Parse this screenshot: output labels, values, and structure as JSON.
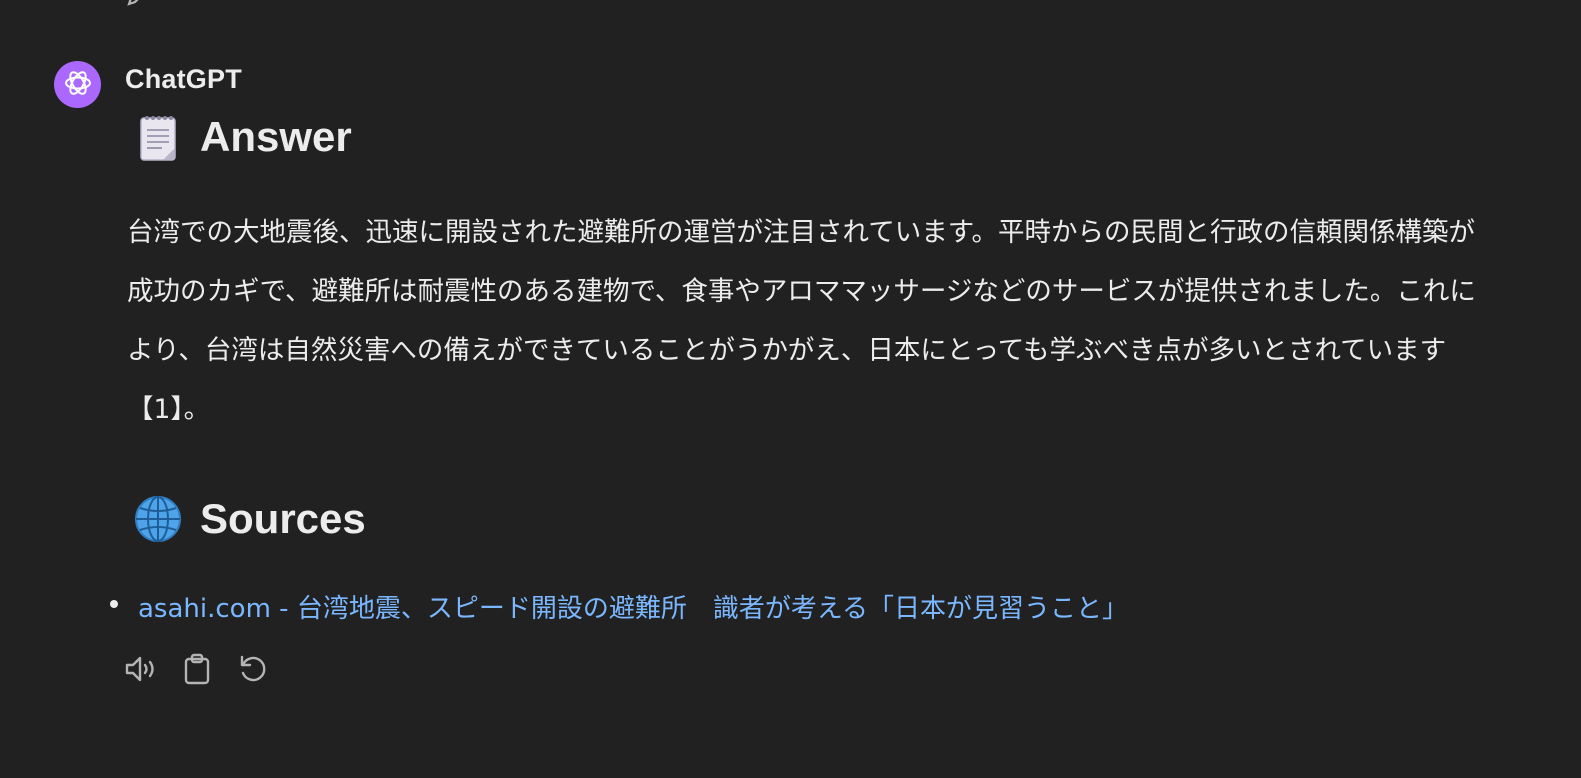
{
  "message": {
    "author": "ChatGPT",
    "answer_heading": "Answer",
    "answer_text": "台湾での大地震後、迅速に開設された避難所の運営が注目されています。平時からの民間と行政の信頼関係構築が成功のカギで、避難所は耐震性のある建物で、食事やアロママッサージなどのサービスが提供されました。これにより、台湾は自然災害への備えができていることがうかがえ、日本にとっても学ぶべき点が多いとされています【1】。",
    "sources_heading": "Sources",
    "sources": [
      {
        "label": "asahi.com - 台湾地震、スピード開設の避難所　識者が考える「日本が見習うこと」"
      }
    ]
  },
  "icons": {
    "avatar": "openai-logo-icon",
    "answer_emoji": "notepad-icon",
    "sources_emoji": "globe-icon",
    "actions": [
      "read-aloud-icon",
      "copy-icon",
      "regenerate-icon"
    ]
  },
  "colors": {
    "background": "#212121",
    "text": "#ececec",
    "link": "#7ab7ff",
    "avatar": "#ab68ff"
  }
}
